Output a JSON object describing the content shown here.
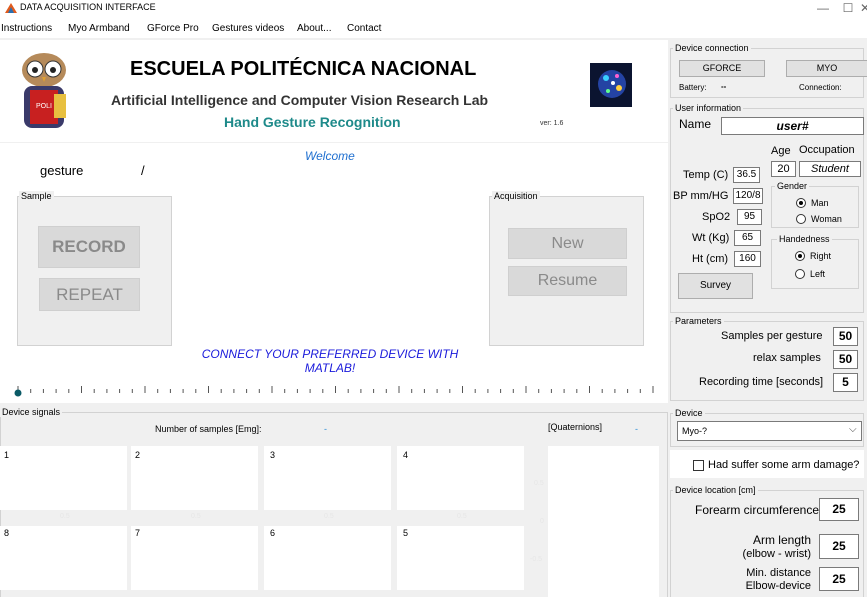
{
  "window": {
    "title": "DATA ACQUISITION INTERFACE",
    "minimize": "—",
    "maximize": "☐",
    "close": "✕"
  },
  "menu": [
    "Instructions",
    "Myo Armband",
    "GForce Pro",
    "Gestures videos",
    "About...",
    "Contact"
  ],
  "header": {
    "school": "ESCUELA POLITÉCNICA NACIONAL",
    "lab": "Artificial Intelligence and Computer Vision Research Lab",
    "project": "Hand Gesture Recognition",
    "version": "ver: 1.6",
    "mascot_text": "POLI"
  },
  "main": {
    "welcome": "Welcome",
    "gesture_label": "gesture",
    "gesture_sep": "/",
    "sample_legend": "Sample",
    "record": "RECORD",
    "repeat": "REPEAT",
    "acquisition_legend": "Acquisition",
    "new": "New",
    "resume": "Resume",
    "message_line1": "CONNECT YOUR PREFERRED DEVICE WITH",
    "message_line2": "MATLAB!"
  },
  "signals": {
    "legend": "Device signals",
    "samples_label": "Number of samples [Emg]:",
    "samples_value": "-",
    "quat_label": "[Quaternions]",
    "quat_value": "-",
    "plots_top": [
      "1",
      "2",
      "3",
      "4"
    ],
    "plots_bottom": [
      "8",
      "7",
      "6",
      "5"
    ],
    "tick_labels": [
      "0.5",
      "0.5",
      "0.5",
      "0.5"
    ],
    "quat_ticks": [
      "0.5",
      "0",
      "-0.5"
    ]
  },
  "device_connection": {
    "legend": "Device connection",
    "gforce": "GFORCE",
    "myo": "MYO",
    "battery_label": "Battery:",
    "battery_value": "--",
    "connection_label": "Connection:"
  },
  "user": {
    "legend": "User information",
    "name_label": "Name",
    "name_value": "user#",
    "age_label": "Age",
    "age_value": "20",
    "occupation_label": "Occupation",
    "occupation_value": "Student",
    "temp_label": "Temp (C)",
    "temp_value": "36.5",
    "bp_label": "BP mm/HG",
    "bp_value": "120/8",
    "spo2_label": "SpO2",
    "spo2_value": "95",
    "wt_label": "Wt (Kg)",
    "wt_value": "65",
    "ht_label": "Ht (cm)",
    "ht_value": "160",
    "gender_legend": "Gender",
    "man": "Man",
    "woman": "Woman",
    "gender_selected": "Man",
    "hand_legend": "Handedness",
    "right": "Right",
    "left": "Left",
    "hand_selected": "Right",
    "survey": "Survey"
  },
  "parameters": {
    "legend": "Parameters",
    "samples_label": "Samples per gesture",
    "samples_value": "50",
    "relax_label": "relax samples",
    "relax_value": "50",
    "rec_label": "Recording time [seconds]",
    "rec_value": "5"
  },
  "device": {
    "legend": "Device",
    "selected": "Myo-?",
    "damage_label": "Had suffer some arm damage?",
    "damage_checked": false
  },
  "location": {
    "legend": "Device location [cm]",
    "forearm_label": "Forearm circumference",
    "forearm_value": "25",
    "arm_label1": "Arm length",
    "arm_label2": "(elbow - wrist)",
    "arm_value": "25",
    "min_label1": "Min. distance",
    "min_label2": "Elbow-device",
    "min_value": "25"
  },
  "colors": {
    "accent_teal": "#1e8a8a",
    "welcome_blue": "#1f6fd0",
    "message_blue": "#1a1adb"
  }
}
